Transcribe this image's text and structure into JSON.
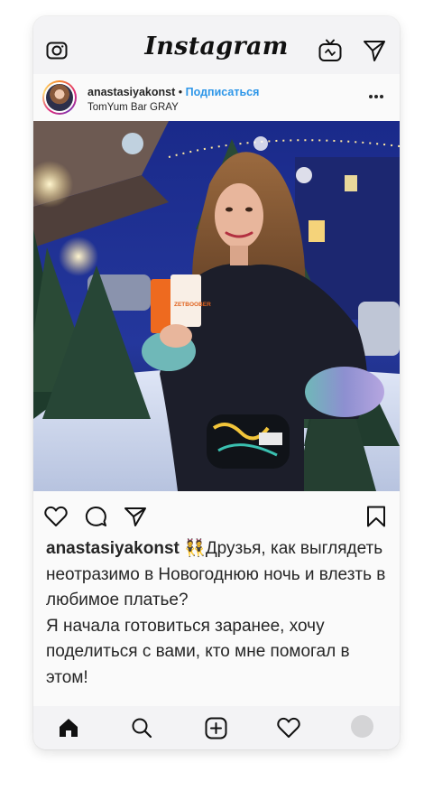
{
  "app": {
    "logo": "Instagram"
  },
  "topbar": {
    "left_icon": "camera-icon",
    "right_icons": [
      "igtv-icon",
      "direct-message-icon"
    ]
  },
  "post": {
    "username": "anastasiyakonst",
    "separator": "•",
    "follow_label": "Подписаться",
    "location": "TomYum Bar GRAY",
    "more_icon": "more-options-icon",
    "actions": {
      "left": [
        "heart-icon",
        "comment-icon",
        "share-icon"
      ],
      "right": "bookmark-icon"
    },
    "caption": {
      "username": "anastasiyakonst",
      "emoji": "👯",
      "text1": "Друзья, как выглядеть неотразимо в Новогоднюю ночь и влезть в любимое платье?",
      "text2": "Я начала готовиться заранее, хочу поделиться с вами, кто мне помогал в этом!"
    },
    "photo": {
      "product_label": "ZETBOOBER"
    }
  },
  "bottom_nav": [
    "home-icon",
    "search-icon",
    "new-post-icon",
    "activity-icon",
    "profile-avatar"
  ],
  "colors": {
    "accent_link": "#2d96e8",
    "text": "#262626",
    "frame_bg": "#f3f3f5"
  }
}
